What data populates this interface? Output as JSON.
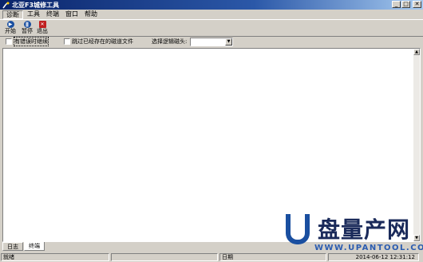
{
  "window": {
    "title": "北亚F3城修工具",
    "controls": {
      "minimize": "_",
      "maximize": "□",
      "close": "✕"
    }
  },
  "menu": [
    "诊断",
    "工具",
    "终端",
    "窗口",
    "帮助"
  ],
  "toolbar": [
    {
      "label": "开始",
      "icon": "start-icon",
      "color": "#1a4fa0"
    },
    {
      "label": "暂停",
      "icon": "pause-icon",
      "color": "#1a4fa0"
    },
    {
      "label": "退出",
      "icon": "exit-icon",
      "color": "#c02020"
    }
  ],
  "options": {
    "checkbox1": "有错误时继续",
    "checkbox2": "跳过已经存在的磁道文件",
    "select_label": "选择逻辑磁头:",
    "select_value": ""
  },
  "tabs": [
    "日志",
    "终端"
  ],
  "status": {
    "left": "就绪",
    "date_label": "日期",
    "datetime": "2014-06-12 12:31:12"
  },
  "watermark": {
    "logo": "U",
    "text": "盘量产网",
    "url": "WWW.UPANTOOL.COM"
  }
}
